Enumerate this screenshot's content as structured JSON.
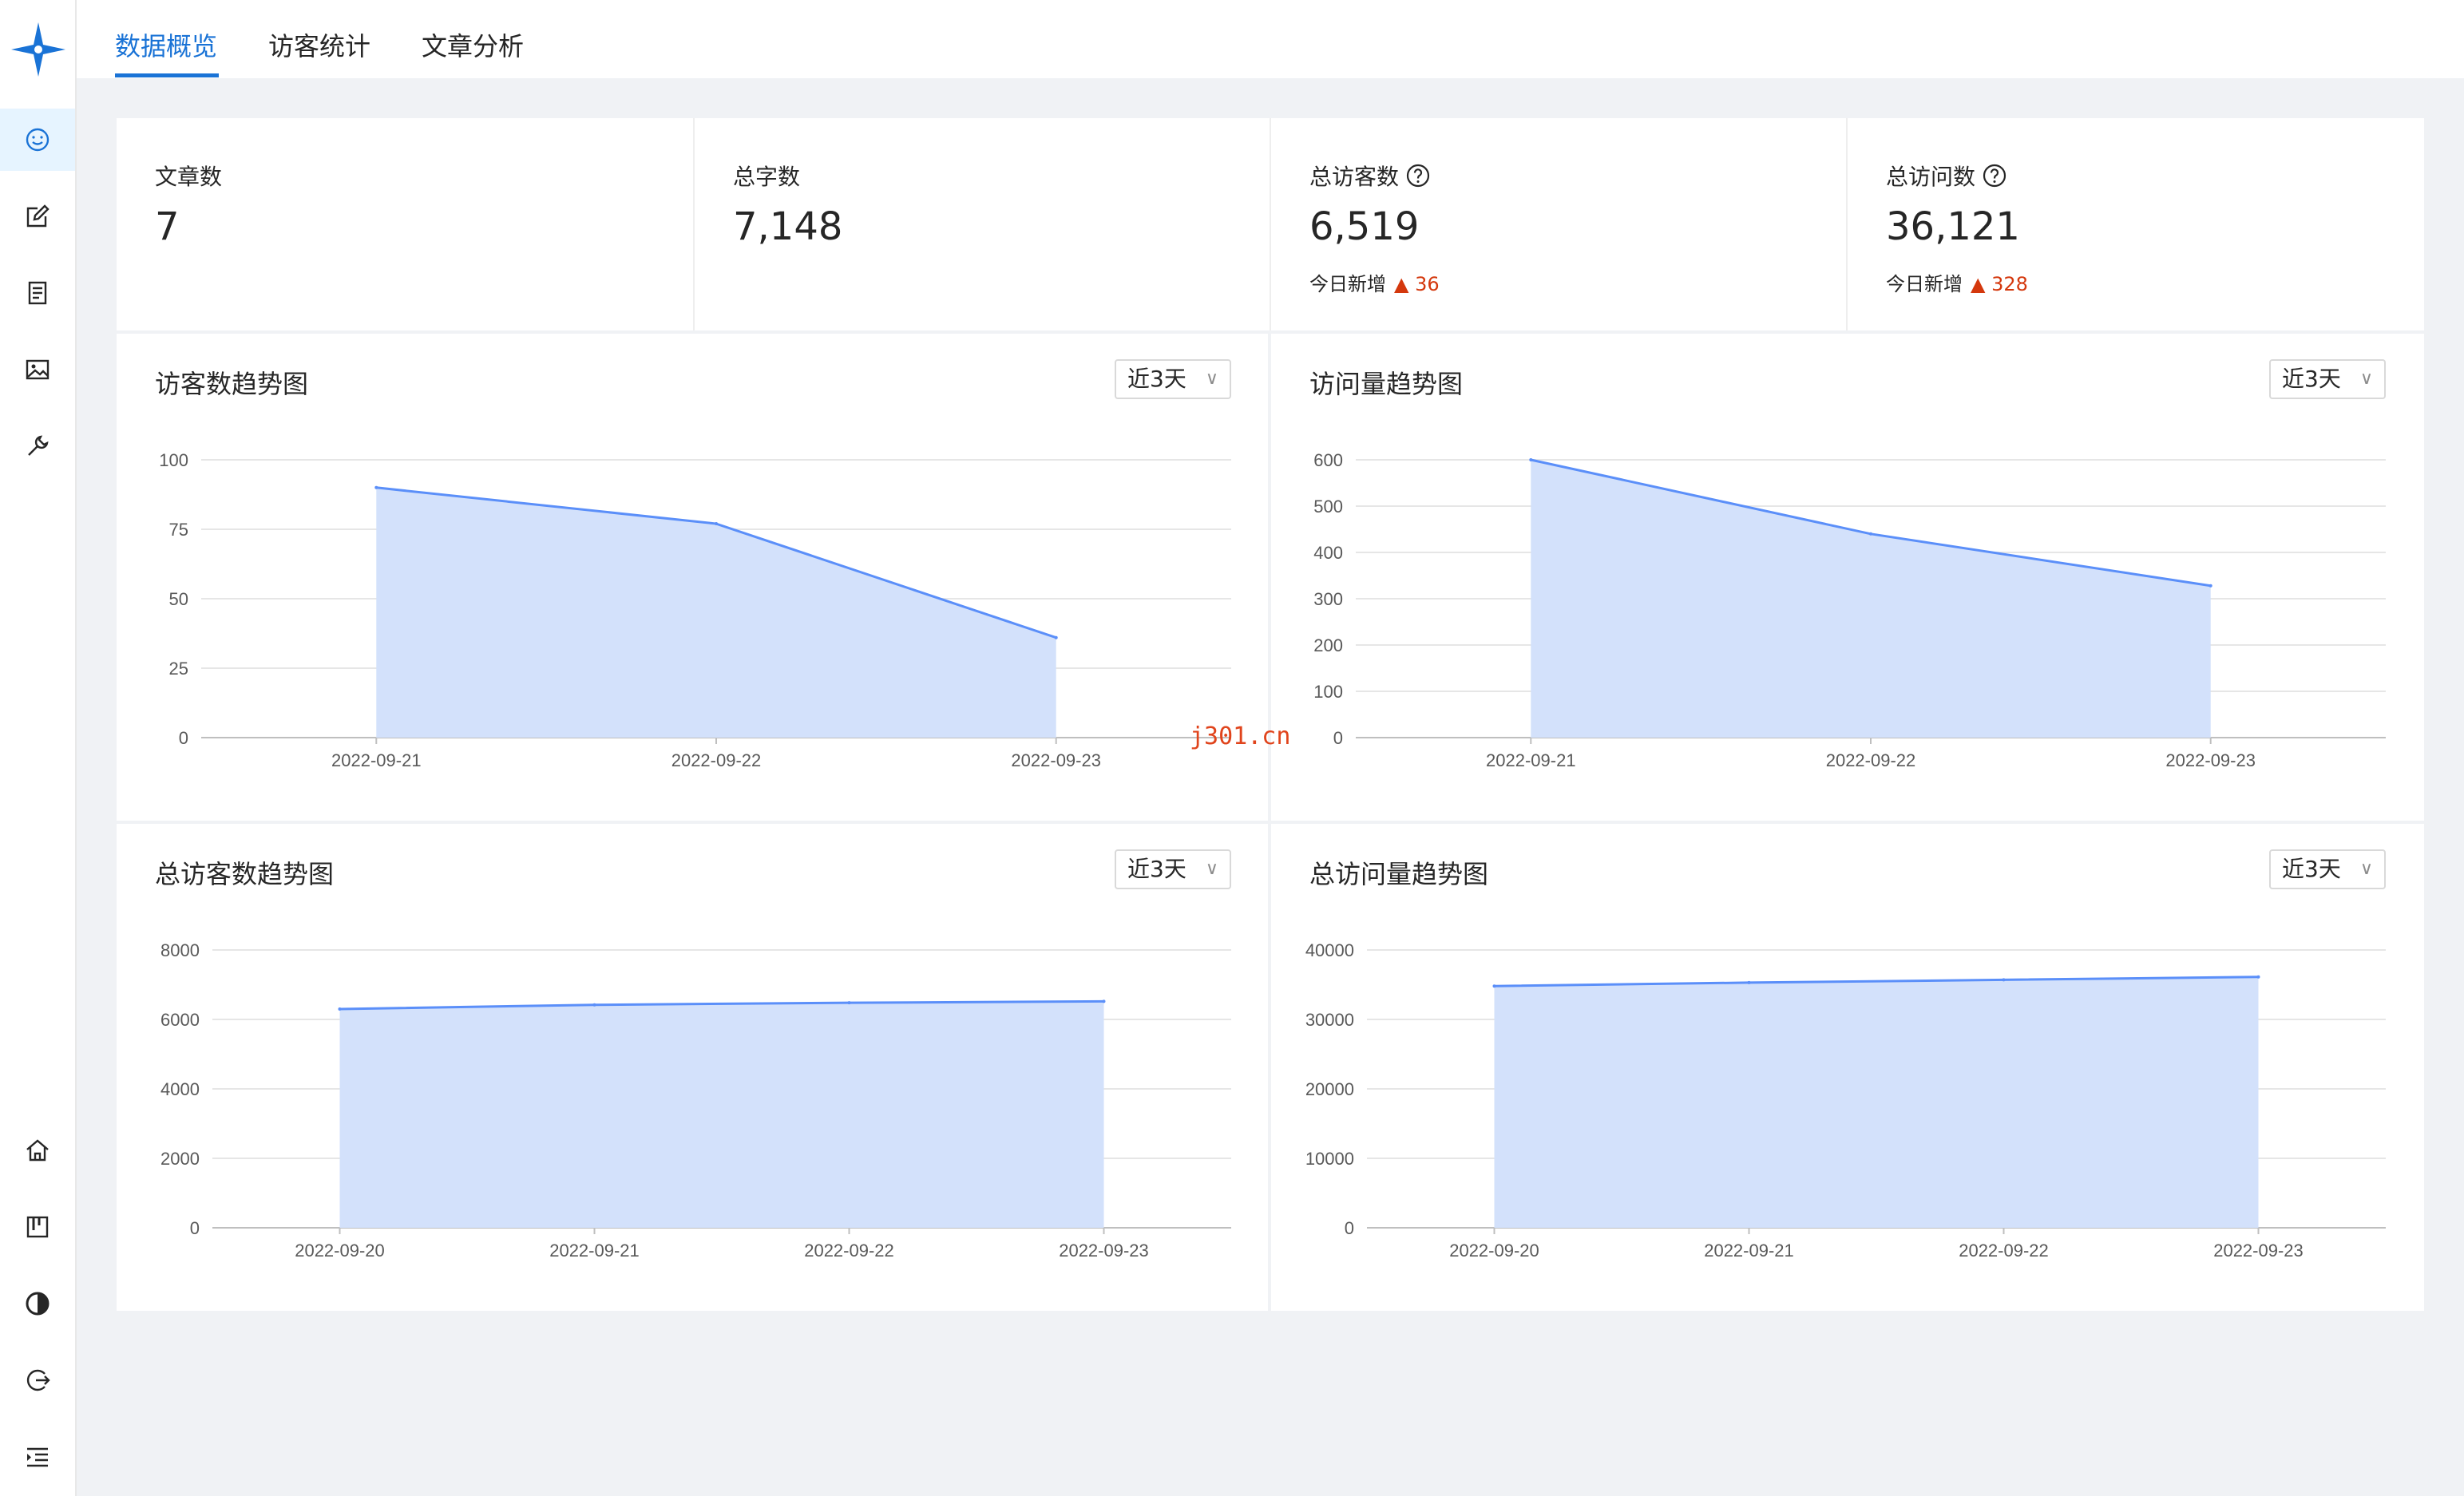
{
  "tabs": [
    {
      "label": "数据概览",
      "active": true
    },
    {
      "label": "访客统计",
      "active": false
    },
    {
      "label": "文章分析",
      "active": false
    }
  ],
  "sidebar": {
    "top_items": [
      {
        "icon": "smiley-icon",
        "active": true
      },
      {
        "icon": "edit-icon",
        "active": false
      },
      {
        "icon": "document-icon",
        "active": false
      },
      {
        "icon": "image-icon",
        "active": false
      },
      {
        "icon": "wrench-icon",
        "active": false
      }
    ],
    "bottom_items": [
      {
        "icon": "home-icon"
      },
      {
        "icon": "kanban-icon"
      },
      {
        "icon": "contrast-icon"
      },
      {
        "icon": "logout-icon"
      },
      {
        "icon": "menu-toggle-icon"
      }
    ]
  },
  "stats": [
    {
      "label": "文章数",
      "value": "7"
    },
    {
      "label": "总字数",
      "value": "7,148"
    },
    {
      "label": "总访客数",
      "value": "6,519",
      "delta_label": "今日新增",
      "delta_value": "▲ 36"
    },
    {
      "label": "总访问数",
      "value": "36,121",
      "delta_label": "今日新增",
      "delta_value": "▲ 328"
    }
  ],
  "range_label": "近3天",
  "watermark": "j301.cn",
  "colors": {
    "accent": "#1a73d6",
    "line": "#5b8ff9",
    "area": "#d3e1fb",
    "up": "#d4380d"
  },
  "chart_data": [
    {
      "type": "area",
      "title": "访客数趋势图",
      "categories": [
        "2022-09-21",
        "2022-09-22",
        "2022-09-23"
      ],
      "values": [
        90,
        77,
        36
      ],
      "yticks": [
        0,
        25,
        50,
        75,
        100
      ],
      "ylim": [
        0,
        100
      ],
      "grid": true
    },
    {
      "type": "area",
      "title": "访问量趋势图",
      "categories": [
        "2022-09-21",
        "2022-09-22",
        "2022-09-23"
      ],
      "values": [
        600,
        440,
        328
      ],
      "yticks": [
        0,
        100,
        200,
        300,
        400,
        500,
        600
      ],
      "ylim": [
        0,
        600
      ],
      "grid": true
    },
    {
      "type": "area",
      "title": "总访客数趋势图",
      "categories": [
        "2022-09-20",
        "2022-09-21",
        "2022-09-22",
        "2022-09-23"
      ],
      "values": [
        6300,
        6420,
        6480,
        6519
      ],
      "yticks": [
        0,
        2000,
        4000,
        6000,
        8000
      ],
      "ylim": [
        0,
        8000
      ],
      "grid": true
    },
    {
      "type": "area",
      "title": "总访问量趋势图",
      "categories": [
        "2022-09-20",
        "2022-09-21",
        "2022-09-22",
        "2022-09-23"
      ],
      "values": [
        34800,
        35300,
        35700,
        36121
      ],
      "yticks": [
        0,
        10000,
        20000,
        30000,
        40000
      ],
      "ylim": [
        0,
        40000
      ],
      "grid": true
    }
  ]
}
